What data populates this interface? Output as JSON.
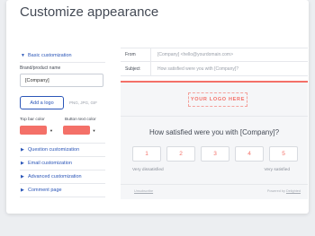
{
  "page": {
    "title": "Customize appearance"
  },
  "sidebar": {
    "basic": {
      "label": "Basic customization",
      "expanded": true
    },
    "brand_label": "Brand/product name",
    "brand_value": "[Company]",
    "add_logo_label": "Add a logo",
    "logo_hint": "PNG, JPG, GIF",
    "top_bar_color_label": "Top bar color",
    "button_text_color_label": "Button text color",
    "top_bar_color": "#f47068",
    "button_text_color": "#f47068",
    "sections": [
      {
        "label": "Question customization"
      },
      {
        "label": "Email customization"
      },
      {
        "label": "Advanced customization"
      },
      {
        "label": "Comment page"
      }
    ]
  },
  "email": {
    "from_label": "From",
    "from_value": "[Company] <hello@yourdomain.com>",
    "subject_label": "Subject",
    "subject_value": "How satisfied were you with [Company]?"
  },
  "preview": {
    "logo_placeholder": "YOUR LOGO HERE",
    "question": "How satisfied were you with [Company]?",
    "scale": [
      "1",
      "2",
      "3",
      "4",
      "5"
    ],
    "low_label": "Very dissatisfied",
    "high_label": "Very satisfied",
    "unsubscribe": "Unsubscribe",
    "powered_prefix": "Powered by ",
    "powered_brand": "Delighted",
    "accent_color": "#f47068"
  }
}
